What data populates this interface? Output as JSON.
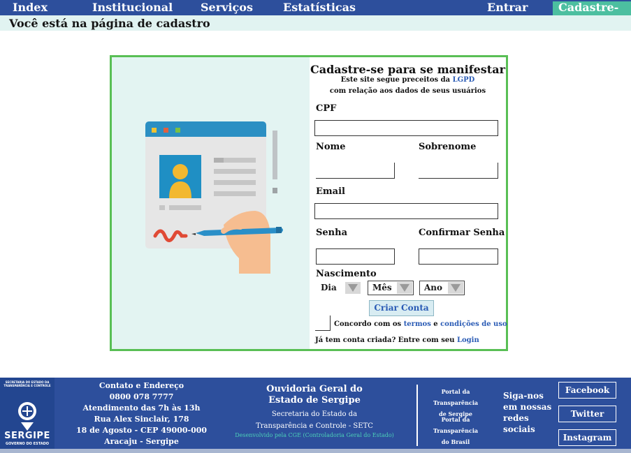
{
  "nav": {
    "index": "Index",
    "institucional": "Institucional",
    "servicos": "Serviços",
    "estatisticas": "Estatísticas",
    "entrar": "Entrar",
    "cadastre": "Cadastre-se"
  },
  "breadcrumb": "Você está na página de cadastro",
  "form": {
    "title": "Cadastre-se para se manifestar",
    "sub1_pre": "Este site segue preceitos da ",
    "sub1_link": "LGPD",
    "sub2": "com relação aos dados de seus usuários",
    "cpf_label": "CPF",
    "nome_label": "Nome",
    "sobrenome_label": "Sobrenome",
    "email_label": "Email",
    "senha_label": "Senha",
    "confirmar_label": "Confirmar Senha",
    "nascimento_label": "Nascimento",
    "dia": "Dia",
    "mes": "Mês",
    "ano": "Ano",
    "submit": "Criar Conta",
    "agree_pre": "Concordo com os ",
    "agree_termos": "termos",
    "agree_mid": " e ",
    "agree_condicoes": "condições de uso",
    "have_account": "Já tem conta criada? Entre com seu ",
    "login_link": "Login"
  },
  "footer": {
    "seal_small": "SECRETARIA DO ESTADO DA TRANSPARÊNCIA E CONTROLE",
    "seal_name": "SERGIPE",
    "seal_gov": "GOVERNO DO ESTADO",
    "contact": [
      "Contato e Endereço",
      "0800 078 7777",
      "Atendimento das 7h às 13h",
      "Rua Alex Sinclair, 178",
      "18 de Agosto - CEP 49000-000",
      "Aracaju - Sergipe"
    ],
    "ouv_title1": "Ouvidoria Geral do",
    "ouv_title2": "Estado de Sergipe",
    "ouv_sub1": "Secretaria do Estado da",
    "ouv_sub2": "Transparência e Controle - SETC",
    "dev": "Desenvolvido pela CGE (Controladoria Geral do Estado)",
    "portal1a": "Portal da Transparência",
    "portal1b": "de Sergipe",
    "portal2a": "Portal da Transparência",
    "portal2b": "do Brasil",
    "siga1": "Siga-nos",
    "siga2": "em nossas",
    "siga3": "redes",
    "siga4": "sociais",
    "facebook": "Facebook",
    "twitter": "Twitter",
    "instagram": "Instagram"
  }
}
